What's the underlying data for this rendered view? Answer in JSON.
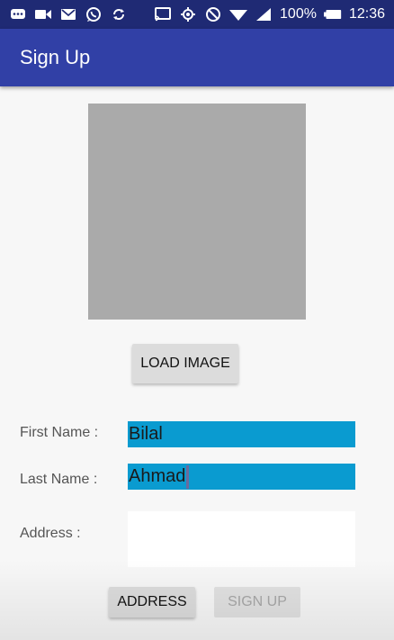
{
  "status_bar": {
    "battery_percent": "100%",
    "time": "12:36",
    "left_icons": [
      "chat-icon",
      "video-icon",
      "gmail-icon",
      "whatsapp-icon",
      "sync-icon"
    ],
    "right_icons": [
      "cast-icon",
      "gps-icon",
      "do-not-disturb-icon",
      "wifi-icon",
      "signal-icon",
      "battery-icon"
    ]
  },
  "app_bar": {
    "title": "Sign Up"
  },
  "image_section": {
    "load_button_label": "LOAD IMAGE",
    "placeholder_color": "#aaaaaa"
  },
  "form": {
    "first_name": {
      "label": "First Name :",
      "value": "Bilal"
    },
    "last_name": {
      "label": "Last Name :",
      "value": "Ahmad"
    },
    "address": {
      "label": "Address :",
      "value": ""
    }
  },
  "actions": {
    "address_button_label": "ADDRESS",
    "signup_button_label": "SIGN UP"
  },
  "colors": {
    "status_bar": "#1f2a74",
    "app_bar": "#3140a6",
    "field_highlight": "#0a9bd0",
    "background": "#f7f7f7"
  }
}
